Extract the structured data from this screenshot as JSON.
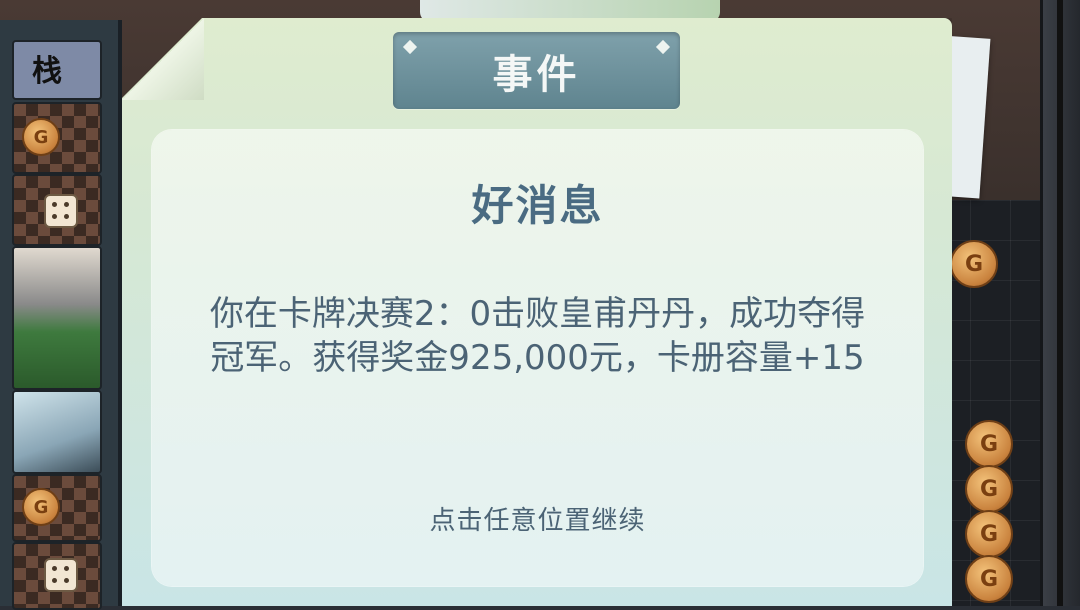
{
  "dialog": {
    "title": "事件",
    "heading": "好消息",
    "message": "你在卡牌决赛2：0击败皇甫丹丹，成功夺得冠军。获得奖金925,000元，卡册容量+15",
    "hint": "点击任意位置继续"
  },
  "side_cards": {
    "glyph": "栈",
    "coin_letter": "G"
  },
  "icons": [
    "coin-icon",
    "dice-icon",
    "printer-card",
    "sword-card"
  ],
  "colors": {
    "title_tab": "#6f939e",
    "heading_text": "#4a6b82",
    "body_text": "#4b6375",
    "dialog_bg": "#d6e8d4"
  }
}
